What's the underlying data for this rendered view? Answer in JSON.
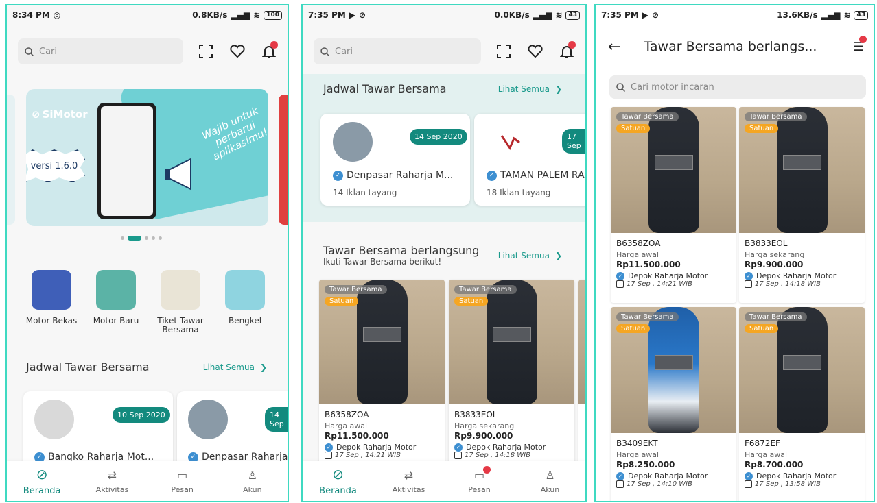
{
  "p1": {
    "status": {
      "time": "8:34 PM",
      "speed": "0.8KB/s",
      "battery": "100"
    },
    "search": {
      "placeholder": "Cari"
    },
    "banner": {
      "logo": "SiMotor",
      "version": "versi 1.6.0",
      "tagline": "Wajib untuk perbarui aplikasimu!"
    },
    "categories": [
      {
        "label": "Motor Bekas",
        "color": "#3f5fb8"
      },
      {
        "label": "Motor Baru",
        "color": "#5bb3a6"
      },
      {
        "label": "Tiket Tawar Bersama",
        "color": "#e9e4d6"
      },
      {
        "label": "Bengkel",
        "color": "#8fd4e0"
      }
    ],
    "section": {
      "title": "Jadwal Tawar Bersama",
      "link": "Lihat Semua"
    },
    "cards": [
      {
        "date": "10 Sep 2020",
        "dealer": "Bangko Raharja Mot..."
      },
      {
        "date": "14 Sep",
        "dealer": "Denpasar Raharja"
      }
    ]
  },
  "p2": {
    "status": {
      "time": "7:35 PM",
      "speed": "0.0KB/s",
      "battery": "43"
    },
    "search": {
      "placeholder": "Cari"
    },
    "jadwal": {
      "title": "Jadwal Tawar Bersama",
      "link": "Lihat Semua"
    },
    "cards": [
      {
        "date": "14 Sep 2020",
        "dealer": "Denpasar Raharja M...",
        "count": "14 Iklan tayang"
      },
      {
        "date": "17 Sep",
        "dealer": "TAMAN PALEM RA",
        "count": "18 Iklan tayang"
      }
    ],
    "tawar": {
      "title": "Tawar Bersama berlangsung",
      "subtitle": "Ikuti Tawar Bersama berikut!",
      "link": "Lihat Semua"
    },
    "products": [
      {
        "tag1": "Tawar Bersama",
        "tag2": "Satuan",
        "code": "B6358ZOA",
        "label": "Harga awal",
        "price": "Rp11.500.000",
        "dealer": "Depok Raharja Motor",
        "time": "17 Sep , 14:21 WIB"
      },
      {
        "tag1": "Tawar Bersama",
        "tag2": "Satuan",
        "code": "B3833EOL",
        "label": "Harga sekarang",
        "price": "Rp9.900.000",
        "dealer": "Depok Raharja Motor",
        "time": "17 Sep , 14:18 WIB"
      }
    ]
  },
  "p3": {
    "status": {
      "time": "7:35 PM",
      "speed": "13.6KB/s",
      "battery": "43"
    },
    "title": "Tawar Bersama berlangs...",
    "search": {
      "placeholder": "Cari motor incaran"
    },
    "products": [
      {
        "tag1": "Tawar Bersama",
        "tag2": "Satuan",
        "code": "B6358ZOA",
        "label": "Harga awal",
        "price": "Rp11.500.000",
        "dealer": "Depok Raharja Motor",
        "time": "17 Sep , 14:21 WIB"
      },
      {
        "tag1": "Tawar Bersama",
        "tag2": "Satuan",
        "code": "B3833EOL",
        "label": "Harga sekarang",
        "price": "Rp9.900.000",
        "dealer": "Depok Raharja Motor",
        "time": "17 Sep , 14:18 WIB"
      },
      {
        "tag1": "Tawar Bersama",
        "tag2": "Satuan",
        "code": "B3409EKT",
        "label": "Harga awal",
        "price": "Rp8.250.000",
        "dealer": "Depok Raharja Motor",
        "time": "17 Sep , 14:10 WIB"
      },
      {
        "tag1": "Tawar Bersama",
        "tag2": "Satuan",
        "code": "F6872EF",
        "label": "Harga awal",
        "price": "Rp8.700.000",
        "dealer": "Depok Raharja Motor",
        "time": "17 Sep , 13:58 WIB"
      }
    ]
  },
  "nav": [
    "Beranda",
    "Aktivitas",
    "Pesan",
    "Akun"
  ],
  "colors": {
    "accent": "#138a7e",
    "badge": "#f5a623",
    "notify": "#e53946"
  }
}
